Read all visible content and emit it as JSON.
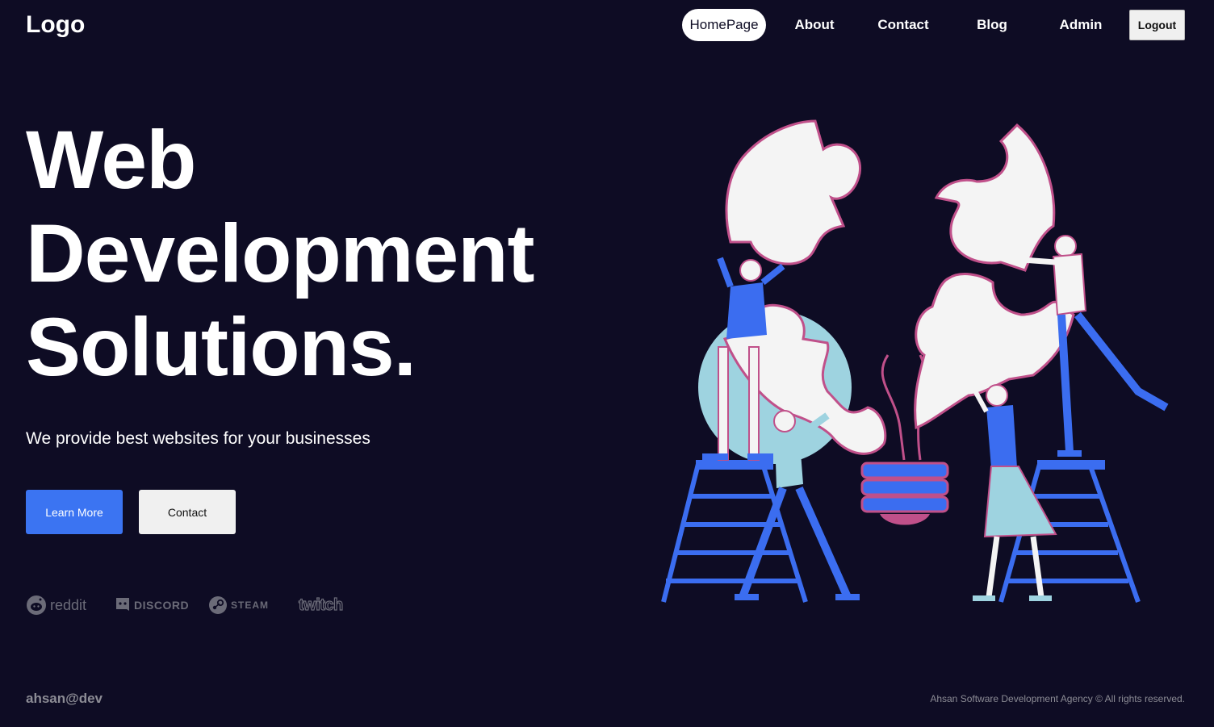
{
  "header": {
    "logo": "Logo",
    "nav": [
      {
        "label": "HomePage",
        "active": true
      },
      {
        "label": "About",
        "active": false
      },
      {
        "label": "Contact",
        "active": false
      },
      {
        "label": "Blog",
        "active": false
      },
      {
        "label": "Admin",
        "active": false
      }
    ],
    "logout_label": "Logout"
  },
  "hero": {
    "title_lines": [
      "Web",
      "Development",
      "Solutions."
    ],
    "subtitle": "We provide best websites for your businesses",
    "primary_button": "Learn More",
    "secondary_button": "Contact"
  },
  "brands": [
    {
      "name": "reddit",
      "icon": "reddit-icon"
    },
    {
      "name": "DISCORD",
      "icon": "discord-icon"
    },
    {
      "name": "STEAM",
      "icon": "steam-icon"
    },
    {
      "name": "twitch",
      "icon": "twitch-logo"
    }
  ],
  "footer": {
    "handle": "ahsan@dev",
    "copyright": "Ahsan Software Development Agency © All rights reserved."
  },
  "colors": {
    "background": "#0e0c24",
    "accent_blue": "#3b74f2",
    "illustration_pink": "#c0508a",
    "illustration_light_blue": "#9ed3e0"
  }
}
